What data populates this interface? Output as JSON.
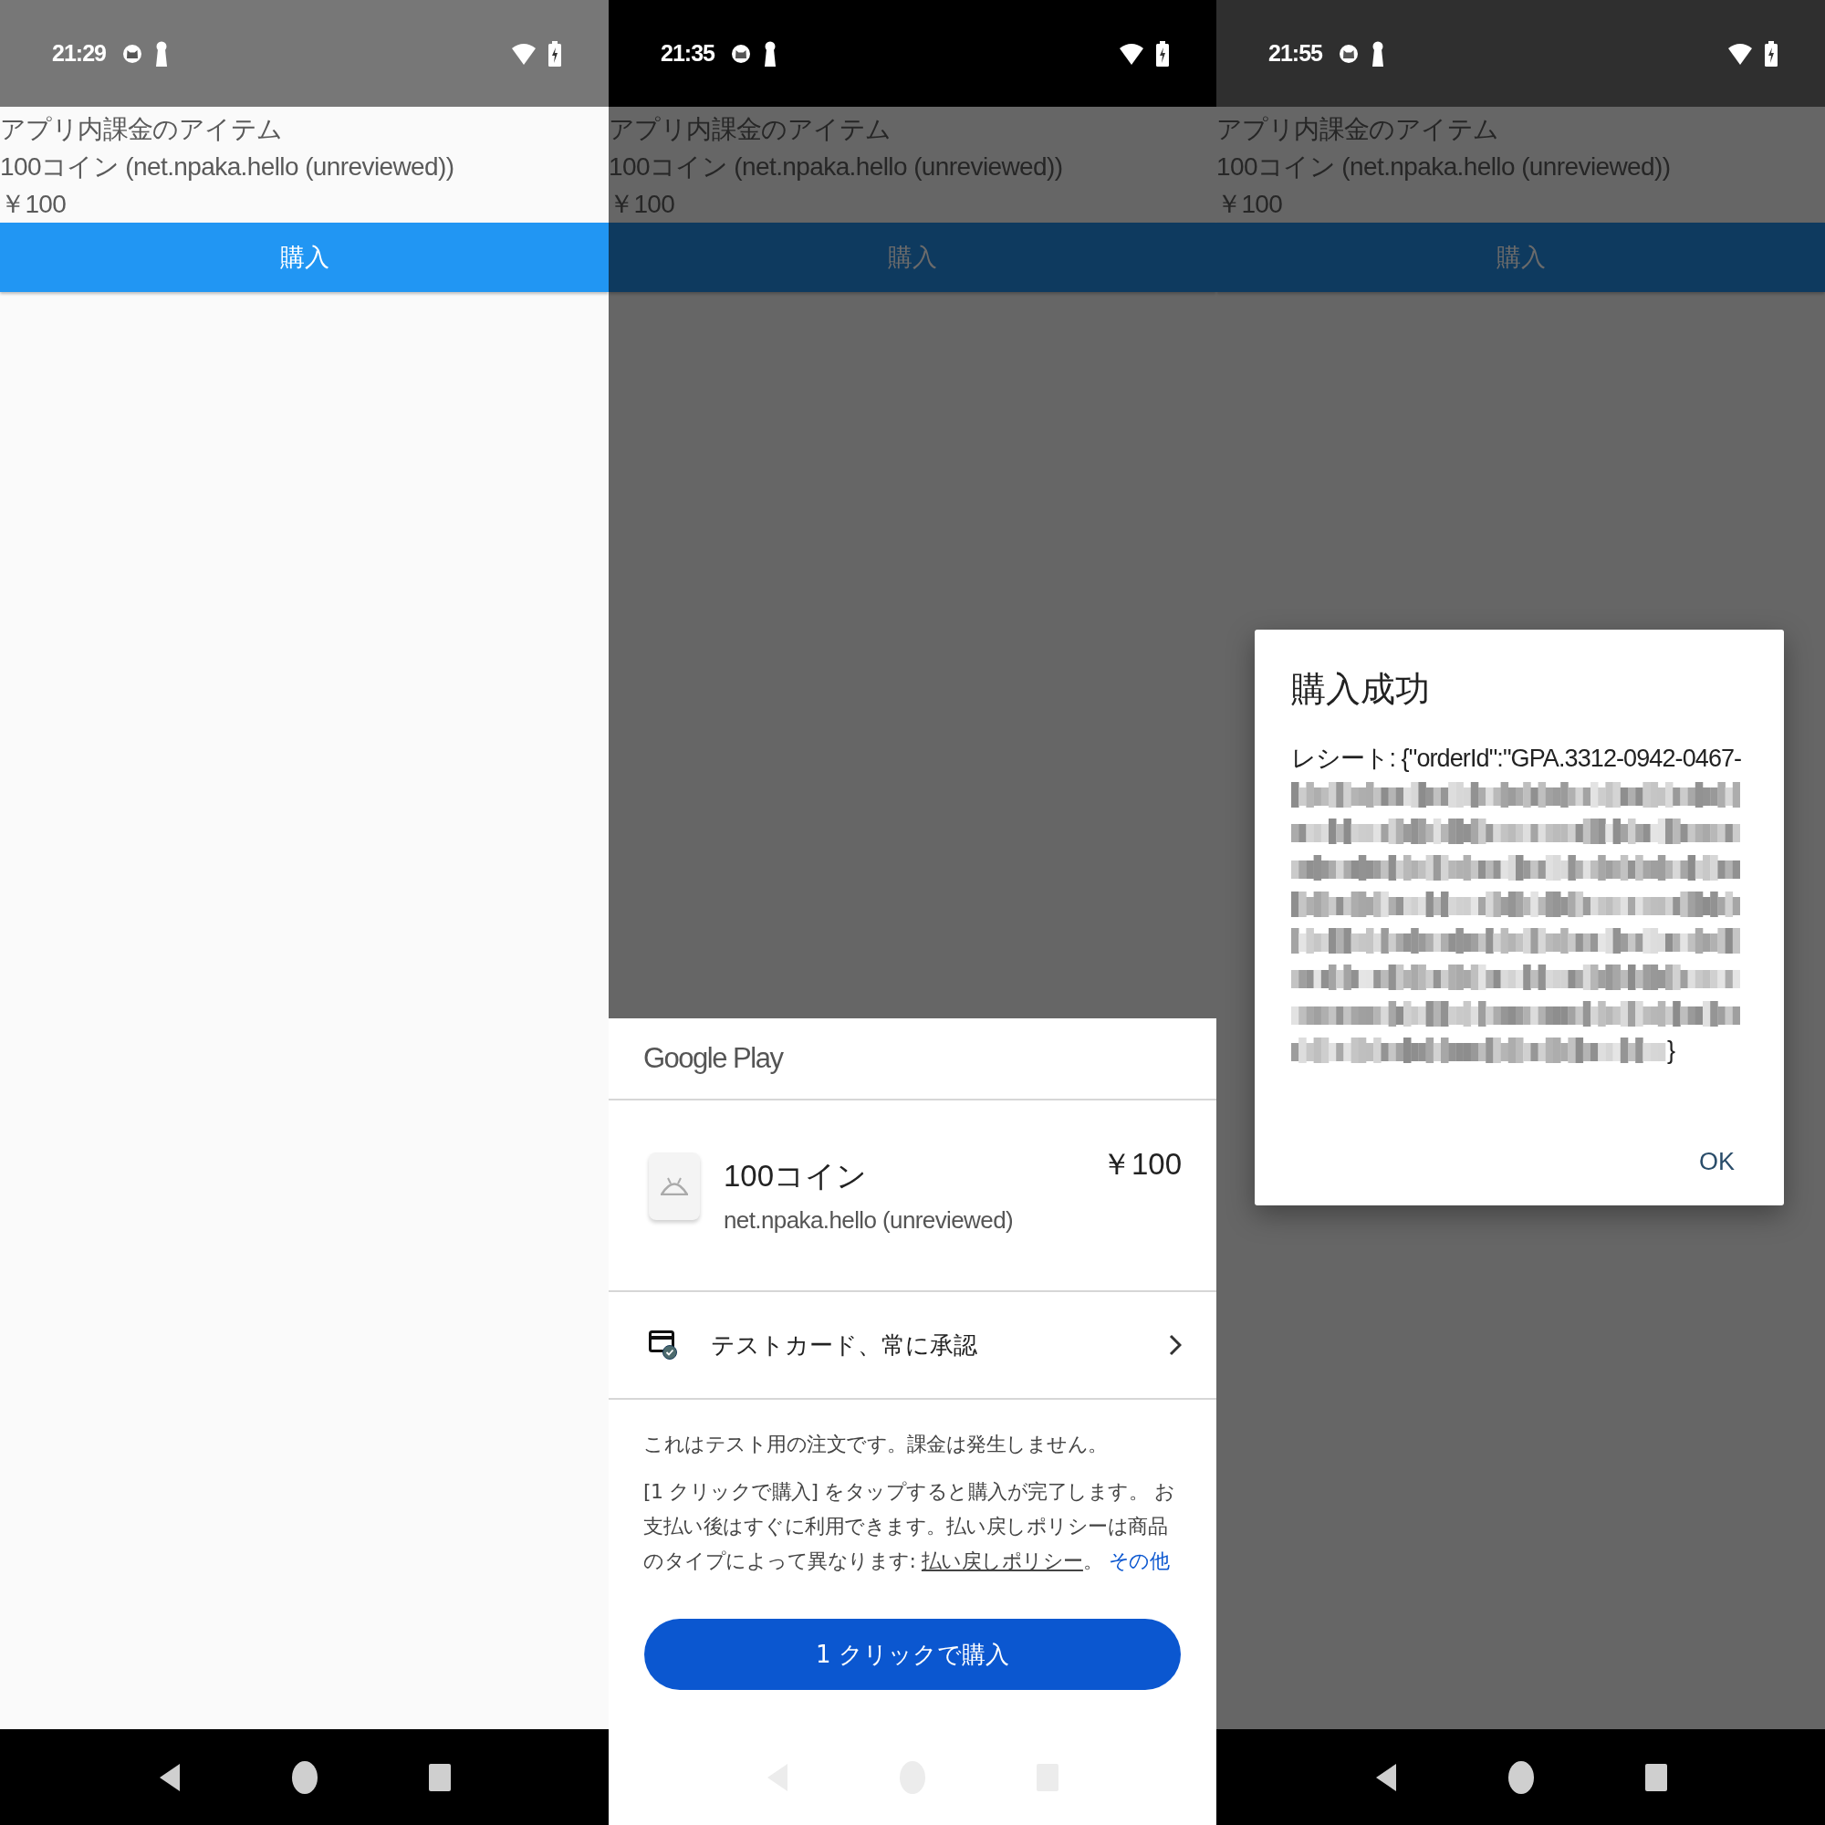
{
  "screens": [
    {
      "status_bar": {
        "time": "21:29"
      },
      "app": {
        "heading": "アプリ内課金のアイテム",
        "product": "100コイン (net.npaka.hello (unreviewed))",
        "price": "￥100",
        "buy_button": "購入"
      }
    },
    {
      "status_bar": {
        "time": "21:35"
      },
      "app": {
        "heading": "アプリ内課金のアイテム",
        "product": "100コイン (net.npaka.hello (unreviewed))",
        "price": "￥100",
        "buy_button": "購入"
      },
      "sheet": {
        "brand": "Google Play",
        "item": {
          "title": "100コイン",
          "subtitle": "net.npaka.hello (unreviewed)",
          "price": "￥100"
        },
        "payment_method": "テストカード、常に承認",
        "notice": "これはテスト用の注文です。課金は発生しません。",
        "terms": {
          "text": "[1 クリックで購入] をタップすると購入が完了します。 お支払い後はすぐに利用できます。払い戻しポリシーは商品のタイプによって異なります: ",
          "policy_link": "払い戻しポリシー",
          "after": "。",
          "more_link": "その他"
        },
        "purchase_button": "1 クリックで購入"
      }
    },
    {
      "status_bar": {
        "time": "21:55"
      },
      "app": {
        "heading": "アプリ内課金のアイテム",
        "product": "100コイン (net.npaka.hello (unreviewed))",
        "price": "￥100",
        "buy_button": "購入"
      },
      "dialog": {
        "title": "購入成功",
        "receipt": "レシート: {\"orderId\":\"GPA.3312-0942-0467-",
        "receipt_end": "}",
        "ok_button": "OK"
      }
    }
  ]
}
